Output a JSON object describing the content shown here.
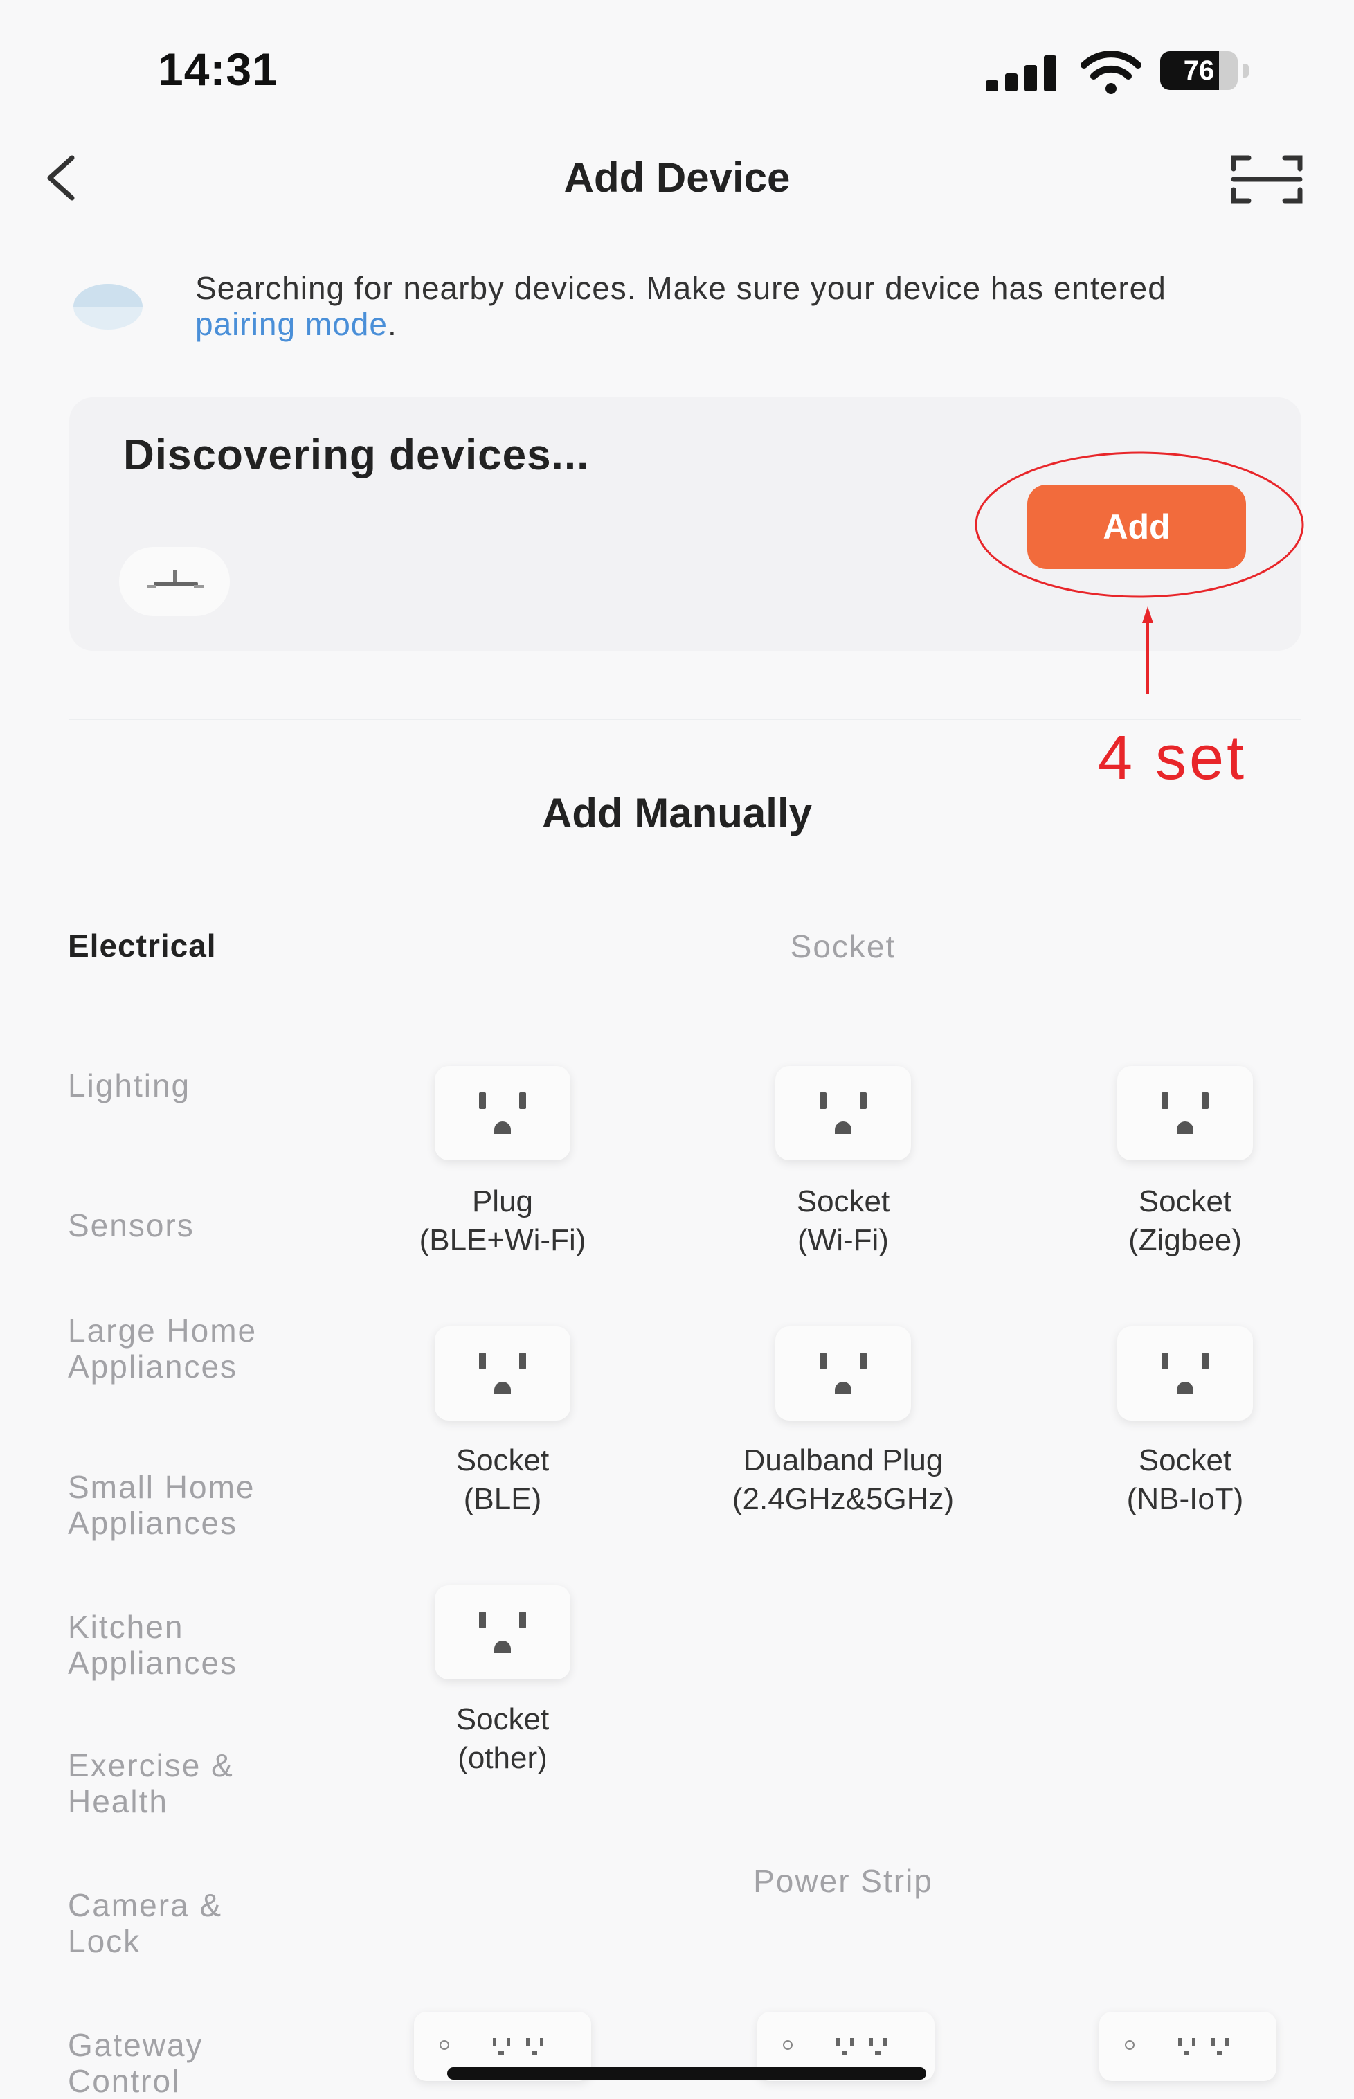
{
  "status": {
    "time": "14:31",
    "battery": "76",
    "battery_level_percent": 76
  },
  "header": {
    "title": "Add Device"
  },
  "search": {
    "text_before": "Searching for nearby devices. Make sure your device has entered",
    "link": "pairing mode",
    "text_after": "."
  },
  "discover": {
    "title": "Discovering devices...",
    "add_label": "Add"
  },
  "annotation": {
    "text": "4 set"
  },
  "manual": {
    "title": "Add Manually"
  },
  "categories": [
    "Electrical",
    "Lighting",
    "Sensors",
    "Large Home Appliances",
    "Small Home Appliances",
    "Kitchen Appliances",
    "Exercise & Health",
    "Camera & Lock",
    "Gateway Control"
  ],
  "groups": {
    "socket": "Socket",
    "power_strip": "Power Strip"
  },
  "devices": [
    {
      "line1": "Plug",
      "line2": "(BLE+Wi-Fi)"
    },
    {
      "line1": "Socket",
      "line2": "(Wi-Fi)"
    },
    {
      "line1": "Socket",
      "line2": "(Zigbee)"
    },
    {
      "line1": "Socket",
      "line2": "(BLE)"
    },
    {
      "line1": "Dualband Plug",
      "line2": "(2.4GHz&5GHz)"
    },
    {
      "line1": "Socket",
      "line2": "(NB-IoT)"
    },
    {
      "line1": "Socket",
      "line2": "(other)"
    }
  ],
  "icons": {
    "back": "chevron-left-icon",
    "scan": "scan-icon",
    "search": "spinner-icon",
    "device": "outlet-icon",
    "strip": "power-strip-icon"
  },
  "colors": {
    "accent": "#f26b3c",
    "link": "#4a8fd8",
    "annotation": "#e8262a"
  }
}
